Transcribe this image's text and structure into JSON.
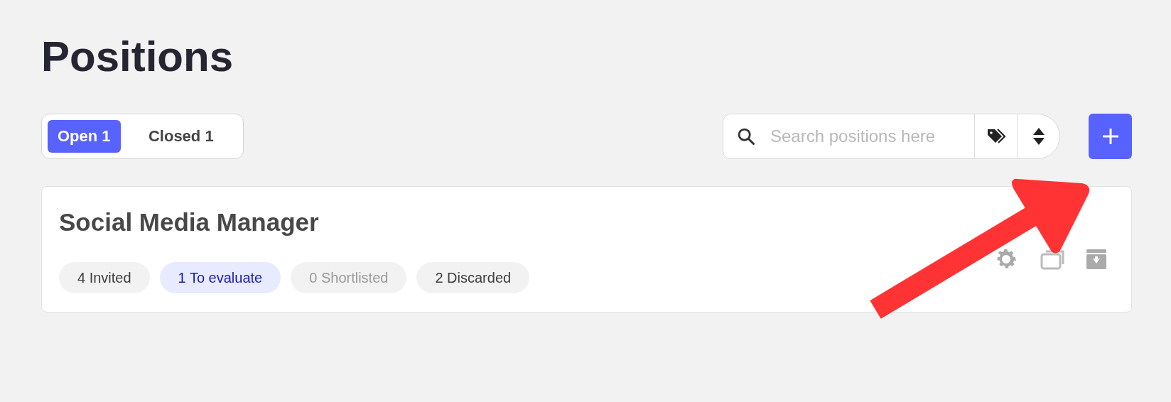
{
  "page": {
    "title": "Positions"
  },
  "tabs": [
    {
      "label": "Open 1",
      "selected": true
    },
    {
      "label": "Closed 1",
      "selected": false
    }
  ],
  "search": {
    "placeholder": "Search positions here"
  },
  "positions": [
    {
      "title": "Social Media Manager",
      "stages": [
        {
          "label": "4 Invited",
          "selected": false,
          "disabled": false
        },
        {
          "label": "1 To evaluate",
          "selected": true,
          "disabled": false
        },
        {
          "label": "0 Shortlisted",
          "selected": false,
          "disabled": true
        },
        {
          "label": "2 Discarded",
          "selected": false,
          "disabled": false
        }
      ]
    }
  ]
}
